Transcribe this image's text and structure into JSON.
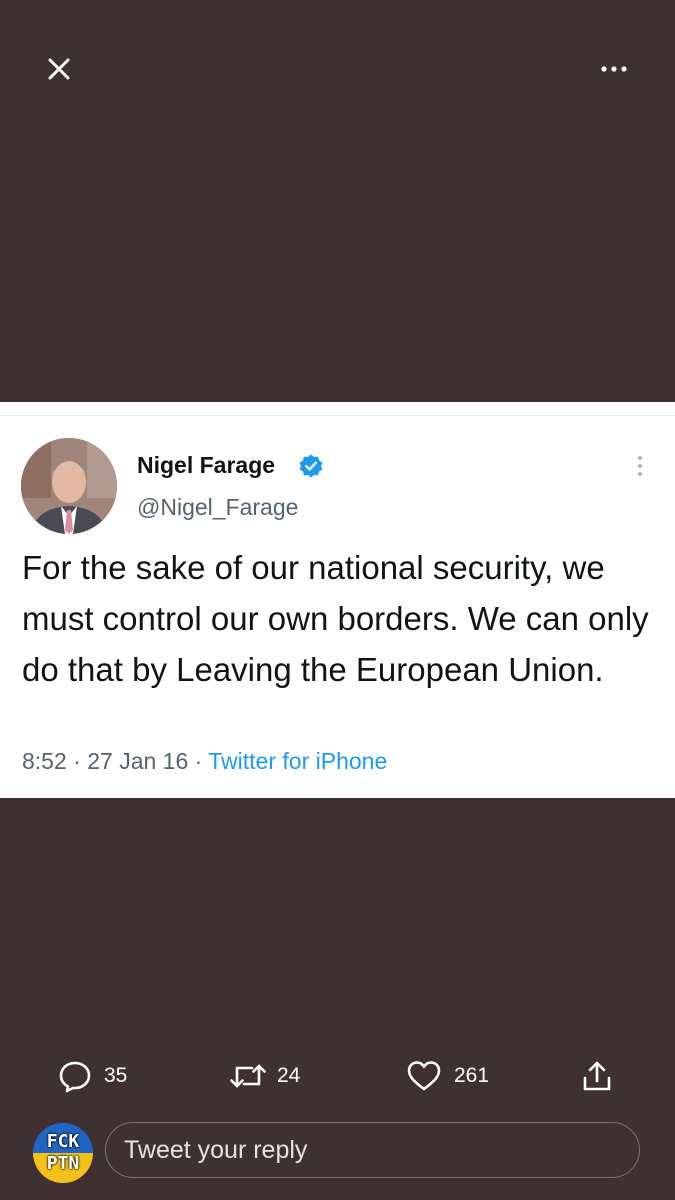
{
  "top_bar": {
    "close_icon": "close-icon",
    "more_icon": "more-horizontal-icon"
  },
  "tweet": {
    "author_name": "Nigel Farage",
    "author_handle": "@Nigel_Farage",
    "verified": true,
    "text": "For the sake of our national security, we must control our own borders. We can only do that by Leaving the European Union.",
    "time": "8:52",
    "date": "27 Jan 16",
    "source": "Twitter for iPhone"
  },
  "actions": {
    "replies": "35",
    "retweets": "24",
    "likes": "261"
  },
  "reply": {
    "placeholder": "Tweet your reply",
    "avatar_line1": "FCK",
    "avatar_line2": "PTN"
  },
  "colors": {
    "background": "#3f3131",
    "link": "#1d9bf0",
    "verified": "#1d9bf0"
  }
}
